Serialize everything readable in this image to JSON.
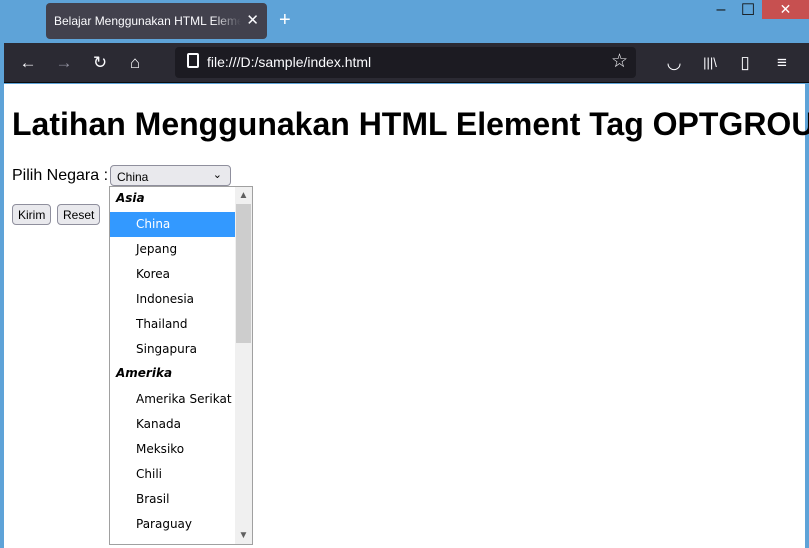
{
  "browser": {
    "tab_title": "Belajar Menggunakan HTML Element Tag OPTGROUP",
    "tab_close": "✕",
    "new_tab": "+",
    "url": "file:///D:/sample/index.html",
    "icons": {
      "back": "←",
      "forward": "→",
      "reload": "↻",
      "home": "⌂",
      "star": "☆",
      "pocket": "◡",
      "library": "|||\\",
      "sidebar": "▯",
      "menu": "≡"
    },
    "window": {
      "minimize": "–",
      "maximize": "☐",
      "close": "✕"
    }
  },
  "page": {
    "heading": "Latihan Menggunakan HTML Element Tag OPTGROUP",
    "label": "Pilih Negara :",
    "select_value": "China",
    "submit_label": "Kirim",
    "reset_label": "Reset"
  },
  "dropdown": {
    "groups": [
      {
        "label": "Asia",
        "options": [
          "China",
          "Jepang",
          "Korea",
          "Indonesia",
          "Thailand",
          "Singapura"
        ]
      },
      {
        "label": "Amerika",
        "options": [
          "Amerika Serikat",
          "Kanada",
          "Meksiko",
          "Chili",
          "Brasil",
          "Paraguay"
        ]
      }
    ],
    "selected": "China"
  }
}
